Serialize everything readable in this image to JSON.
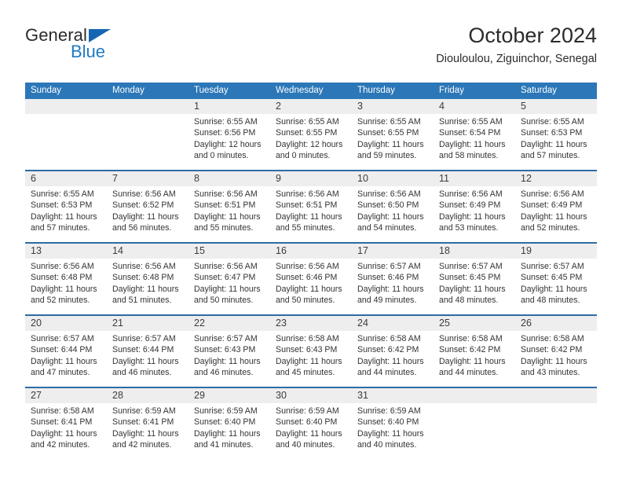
{
  "brand": {
    "name_top": "General",
    "name_bottom": "Blue",
    "triangle_color": "#1667b2",
    "blue_text_color": "#1f7ac4"
  },
  "header": {
    "title": "October 2024",
    "subtitle": "Diouloulou, Ziguinchor, Senegal"
  },
  "theme": {
    "header_band": "#2b77b8",
    "week_divider": "#2e6ca4",
    "date_strip": "#eeeeee",
    "text": "#333333"
  },
  "weekday_headers": [
    "Sunday",
    "Monday",
    "Tuesday",
    "Wednesday",
    "Thursday",
    "Friday",
    "Saturday"
  ],
  "weeks": [
    [
      {
        "day": "",
        "empty": true,
        "line1": "",
        "line2": "",
        "line3": "",
        "line4": ""
      },
      {
        "day": "",
        "empty": true,
        "line1": "",
        "line2": "",
        "line3": "",
        "line4": ""
      },
      {
        "day": "1",
        "empty": false,
        "line1": "Sunrise: 6:55 AM",
        "line2": "Sunset: 6:56 PM",
        "line3": "Daylight: 12 hours",
        "line4": "and 0 minutes."
      },
      {
        "day": "2",
        "empty": false,
        "line1": "Sunrise: 6:55 AM",
        "line2": "Sunset: 6:55 PM",
        "line3": "Daylight: 12 hours",
        "line4": "and 0 minutes."
      },
      {
        "day": "3",
        "empty": false,
        "line1": "Sunrise: 6:55 AM",
        "line2": "Sunset: 6:55 PM",
        "line3": "Daylight: 11 hours",
        "line4": "and 59 minutes."
      },
      {
        "day": "4",
        "empty": false,
        "line1": "Sunrise: 6:55 AM",
        "line2": "Sunset: 6:54 PM",
        "line3": "Daylight: 11 hours",
        "line4": "and 58 minutes."
      },
      {
        "day": "5",
        "empty": false,
        "line1": "Sunrise: 6:55 AM",
        "line2": "Sunset: 6:53 PM",
        "line3": "Daylight: 11 hours",
        "line4": "and 57 minutes."
      }
    ],
    [
      {
        "day": "6",
        "empty": false,
        "line1": "Sunrise: 6:55 AM",
        "line2": "Sunset: 6:53 PM",
        "line3": "Daylight: 11 hours",
        "line4": "and 57 minutes."
      },
      {
        "day": "7",
        "empty": false,
        "line1": "Sunrise: 6:56 AM",
        "line2": "Sunset: 6:52 PM",
        "line3": "Daylight: 11 hours",
        "line4": "and 56 minutes."
      },
      {
        "day": "8",
        "empty": false,
        "line1": "Sunrise: 6:56 AM",
        "line2": "Sunset: 6:51 PM",
        "line3": "Daylight: 11 hours",
        "line4": "and 55 minutes."
      },
      {
        "day": "9",
        "empty": false,
        "line1": "Sunrise: 6:56 AM",
        "line2": "Sunset: 6:51 PM",
        "line3": "Daylight: 11 hours",
        "line4": "and 55 minutes."
      },
      {
        "day": "10",
        "empty": false,
        "line1": "Sunrise: 6:56 AM",
        "line2": "Sunset: 6:50 PM",
        "line3": "Daylight: 11 hours",
        "line4": "and 54 minutes."
      },
      {
        "day": "11",
        "empty": false,
        "line1": "Sunrise: 6:56 AM",
        "line2": "Sunset: 6:49 PM",
        "line3": "Daylight: 11 hours",
        "line4": "and 53 minutes."
      },
      {
        "day": "12",
        "empty": false,
        "line1": "Sunrise: 6:56 AM",
        "line2": "Sunset: 6:49 PM",
        "line3": "Daylight: 11 hours",
        "line4": "and 52 minutes."
      }
    ],
    [
      {
        "day": "13",
        "empty": false,
        "line1": "Sunrise: 6:56 AM",
        "line2": "Sunset: 6:48 PM",
        "line3": "Daylight: 11 hours",
        "line4": "and 52 minutes."
      },
      {
        "day": "14",
        "empty": false,
        "line1": "Sunrise: 6:56 AM",
        "line2": "Sunset: 6:48 PM",
        "line3": "Daylight: 11 hours",
        "line4": "and 51 minutes."
      },
      {
        "day": "15",
        "empty": false,
        "line1": "Sunrise: 6:56 AM",
        "line2": "Sunset: 6:47 PM",
        "line3": "Daylight: 11 hours",
        "line4": "and 50 minutes."
      },
      {
        "day": "16",
        "empty": false,
        "line1": "Sunrise: 6:56 AM",
        "line2": "Sunset: 6:46 PM",
        "line3": "Daylight: 11 hours",
        "line4": "and 50 minutes."
      },
      {
        "day": "17",
        "empty": false,
        "line1": "Sunrise: 6:57 AM",
        "line2": "Sunset: 6:46 PM",
        "line3": "Daylight: 11 hours",
        "line4": "and 49 minutes."
      },
      {
        "day": "18",
        "empty": false,
        "line1": "Sunrise: 6:57 AM",
        "line2": "Sunset: 6:45 PM",
        "line3": "Daylight: 11 hours",
        "line4": "and 48 minutes."
      },
      {
        "day": "19",
        "empty": false,
        "line1": "Sunrise: 6:57 AM",
        "line2": "Sunset: 6:45 PM",
        "line3": "Daylight: 11 hours",
        "line4": "and 48 minutes."
      }
    ],
    [
      {
        "day": "20",
        "empty": false,
        "line1": "Sunrise: 6:57 AM",
        "line2": "Sunset: 6:44 PM",
        "line3": "Daylight: 11 hours",
        "line4": "and 47 minutes."
      },
      {
        "day": "21",
        "empty": false,
        "line1": "Sunrise: 6:57 AM",
        "line2": "Sunset: 6:44 PM",
        "line3": "Daylight: 11 hours",
        "line4": "and 46 minutes."
      },
      {
        "day": "22",
        "empty": false,
        "line1": "Sunrise: 6:57 AM",
        "line2": "Sunset: 6:43 PM",
        "line3": "Daylight: 11 hours",
        "line4": "and 46 minutes."
      },
      {
        "day": "23",
        "empty": false,
        "line1": "Sunrise: 6:58 AM",
        "line2": "Sunset: 6:43 PM",
        "line3": "Daylight: 11 hours",
        "line4": "and 45 minutes."
      },
      {
        "day": "24",
        "empty": false,
        "line1": "Sunrise: 6:58 AM",
        "line2": "Sunset: 6:42 PM",
        "line3": "Daylight: 11 hours",
        "line4": "and 44 minutes."
      },
      {
        "day": "25",
        "empty": false,
        "line1": "Sunrise: 6:58 AM",
        "line2": "Sunset: 6:42 PM",
        "line3": "Daylight: 11 hours",
        "line4": "and 44 minutes."
      },
      {
        "day": "26",
        "empty": false,
        "line1": "Sunrise: 6:58 AM",
        "line2": "Sunset: 6:42 PM",
        "line3": "Daylight: 11 hours",
        "line4": "and 43 minutes."
      }
    ],
    [
      {
        "day": "27",
        "empty": false,
        "line1": "Sunrise: 6:58 AM",
        "line2": "Sunset: 6:41 PM",
        "line3": "Daylight: 11 hours",
        "line4": "and 42 minutes."
      },
      {
        "day": "28",
        "empty": false,
        "line1": "Sunrise: 6:59 AM",
        "line2": "Sunset: 6:41 PM",
        "line3": "Daylight: 11 hours",
        "line4": "and 42 minutes."
      },
      {
        "day": "29",
        "empty": false,
        "line1": "Sunrise: 6:59 AM",
        "line2": "Sunset: 6:40 PM",
        "line3": "Daylight: 11 hours",
        "line4": "and 41 minutes."
      },
      {
        "day": "30",
        "empty": false,
        "line1": "Sunrise: 6:59 AM",
        "line2": "Sunset: 6:40 PM",
        "line3": "Daylight: 11 hours",
        "line4": "and 40 minutes."
      },
      {
        "day": "31",
        "empty": false,
        "line1": "Sunrise: 6:59 AM",
        "line2": "Sunset: 6:40 PM",
        "line3": "Daylight: 11 hours",
        "line4": "and 40 minutes."
      },
      {
        "day": "",
        "empty": true,
        "line1": "",
        "line2": "",
        "line3": "",
        "line4": ""
      },
      {
        "day": "",
        "empty": true,
        "line1": "",
        "line2": "",
        "line3": "",
        "line4": ""
      }
    ]
  ]
}
